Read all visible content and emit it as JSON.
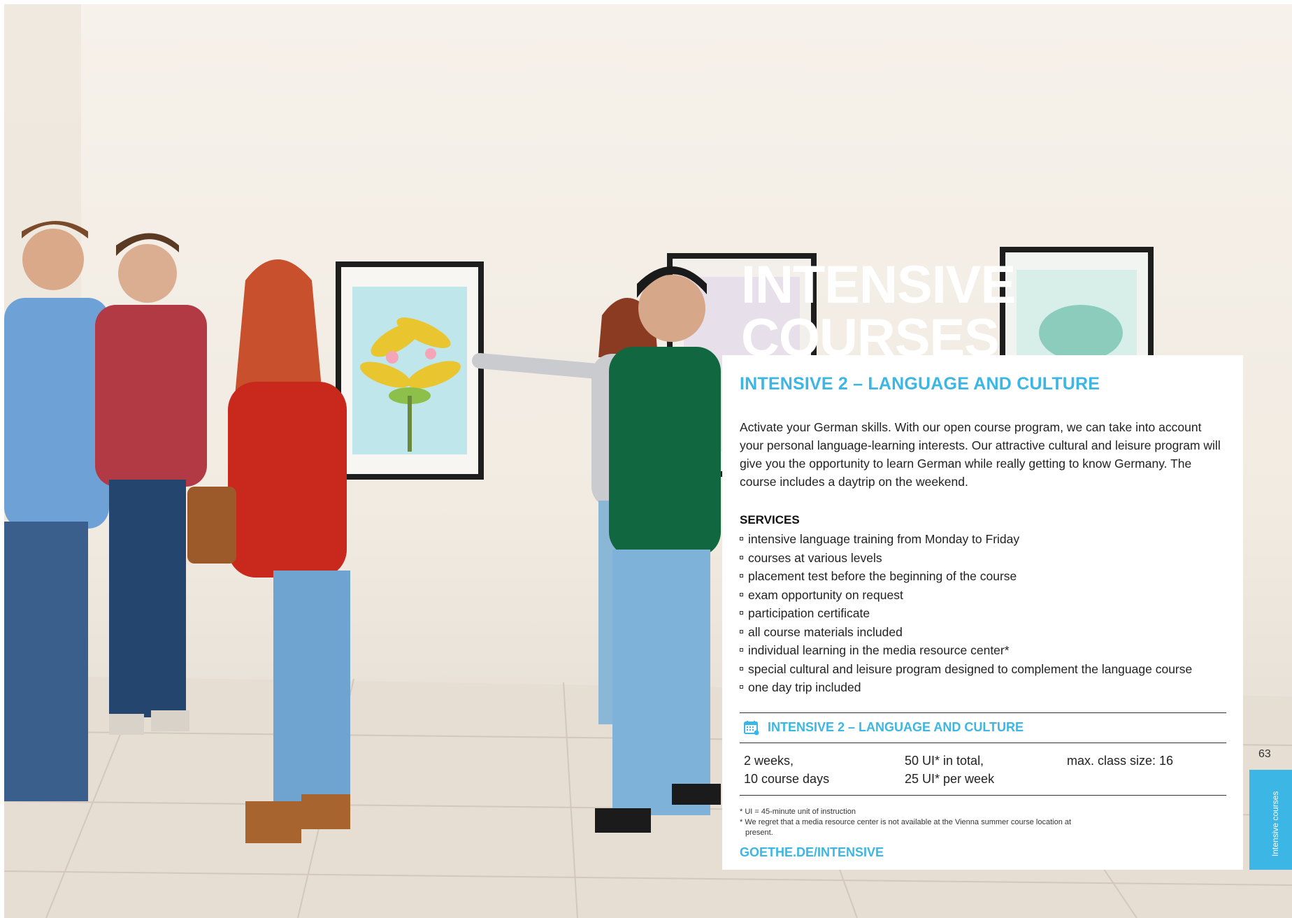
{
  "page_title": [
    "INTENSIVE",
    "COURSES"
  ],
  "card": {
    "heading": "INTENSIVE 2 – LANGUAGE AND CULTURE",
    "intro": "Activate your German skills. With our open course program, we can take into account your personal language-learning interests. Our attractive cultural and leisure program will give you the opportunity to learn German while really getting to know Germany. The course includes a daytrip on the weekend.",
    "services_title": "SERVICES",
    "services": [
      "intensive language training from Monday to Friday",
      "courses at various levels",
      "placement test before the beginning of the course",
      "exam opportunity on request",
      "participation certificate",
      "all course materials included",
      "individual learning in the media resource center*",
      "special cultural and leisure program designed to complement the language course",
      "one day trip included"
    ],
    "info_heading": "INTENSIVE 2 – LANGUAGE AND CULTURE",
    "info_icon": "calendar-icon",
    "info": {
      "duration": [
        "2 weeks,",
        "10 course days"
      ],
      "units": [
        "50 UI* in total,",
        "25 UI* per week"
      ],
      "class_size": "max. class size: 16"
    },
    "footnotes": [
      "* UI = 45-minute unit of instruction",
      "* We regret that a media resource center is not available at the Vienna summer course location at",
      "present."
    ],
    "url": "GOETHE.DE/INTENSIVE"
  },
  "page_number": "63",
  "side_tab": "Intensive courses",
  "colors": {
    "accent": "#3cb6e4",
    "text": "#222222"
  }
}
